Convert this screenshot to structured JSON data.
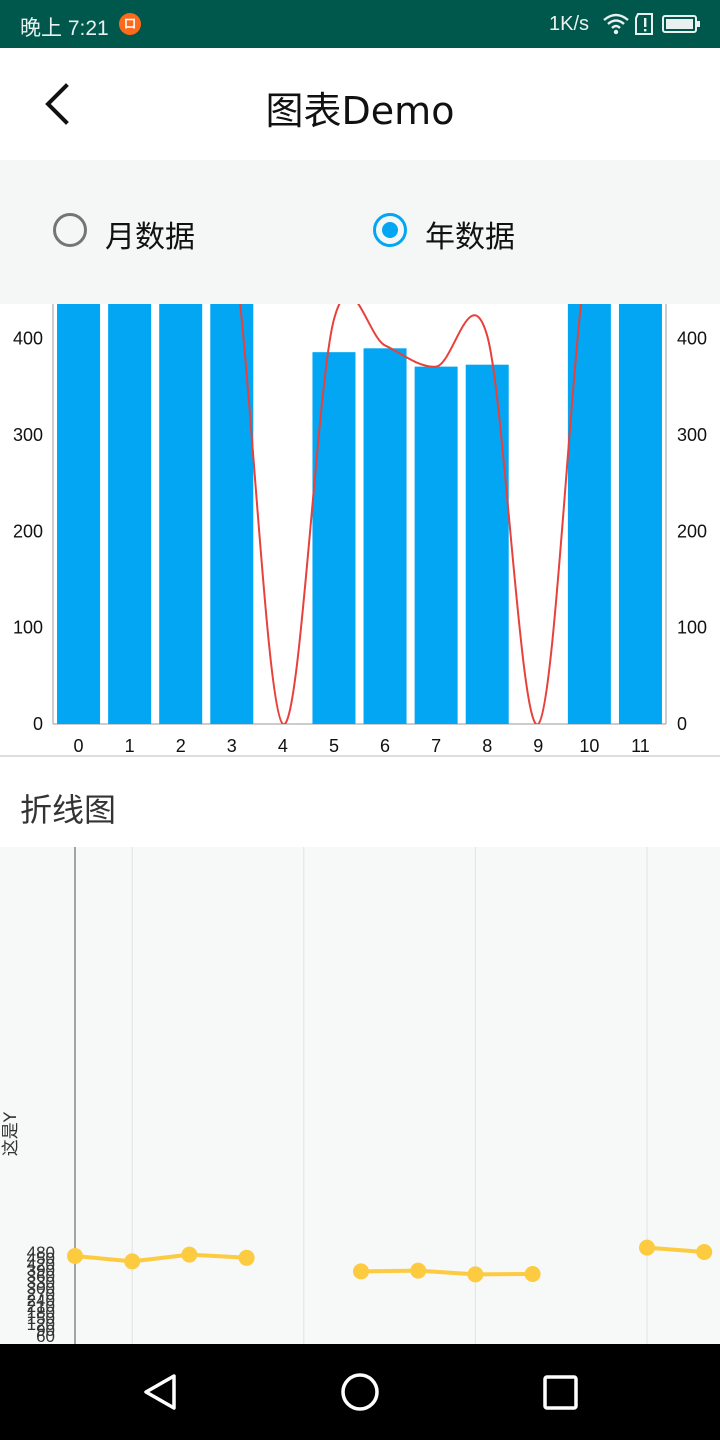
{
  "status_bar": {
    "time": "晚上 7:21",
    "notification_glyph": "ロ",
    "net_speed": "1K/s",
    "icons": [
      "notification-app-icon",
      "wifi-icon",
      "alert-icon",
      "battery-icon"
    ]
  },
  "app_bar": {
    "title": "图表Demo",
    "back_icon": "chevron-left-icon"
  },
  "radio_group": {
    "options": [
      {
        "label": "月数据",
        "selected": false
      },
      {
        "label": "年数据",
        "selected": true
      }
    ]
  },
  "colors": {
    "accent": "#03a6f2",
    "status_bar": "#00574b",
    "curve": "#e8413c",
    "line_series": "#fccb3f"
  },
  "chart_data": [
    {
      "type": "bar",
      "categories": [
        "0",
        "1",
        "2",
        "3",
        "4",
        "5",
        "6",
        "7",
        "8",
        "9",
        "10",
        "11"
      ],
      "values": [
        500,
        500,
        500,
        500,
        0,
        386,
        390,
        371,
        373,
        0,
        500,
        500
      ],
      "left_y_ticks": [
        "0",
        "100",
        "200",
        "300",
        "400"
      ],
      "right_y_ticks": [
        "0",
        "100",
        "200",
        "300",
        "400"
      ],
      "ylim": [
        0,
        436
      ],
      "overlay_curve": {
        "type": "line",
        "smooth": true,
        "values": [
          500,
          500,
          500,
          500,
          0,
          420,
          393,
          371,
          403,
          0,
          500,
          500
        ]
      }
    },
    {
      "type": "line",
      "title": "折线图",
      "ylabel": "这是Y",
      "y_ticks": [
        "60",
        "90",
        "120",
        "150",
        "180",
        "210",
        "240",
        "270",
        "300",
        "330",
        "360",
        "390",
        "420",
        "450",
        "480"
      ],
      "ylim": [
        50,
        505
      ],
      "segments": [
        [
          {
            "x": 0,
            "y": 460
          },
          {
            "x": 1,
            "y": 433
          },
          {
            "x": 2,
            "y": 467
          },
          {
            "x": 3,
            "y": 451
          }
        ],
        [
          {
            "x": 5,
            "y": 383
          },
          {
            "x": 6,
            "y": 387
          },
          {
            "x": 7,
            "y": 368
          },
          {
            "x": 8,
            "y": 370
          }
        ],
        [
          {
            "x": 10,
            "y": 502
          },
          {
            "x": 11,
            "y": 480
          }
        ]
      ]
    }
  ],
  "nav_bar": {
    "buttons": [
      "back-triangle-icon",
      "home-circle-icon",
      "recents-square-icon"
    ]
  }
}
